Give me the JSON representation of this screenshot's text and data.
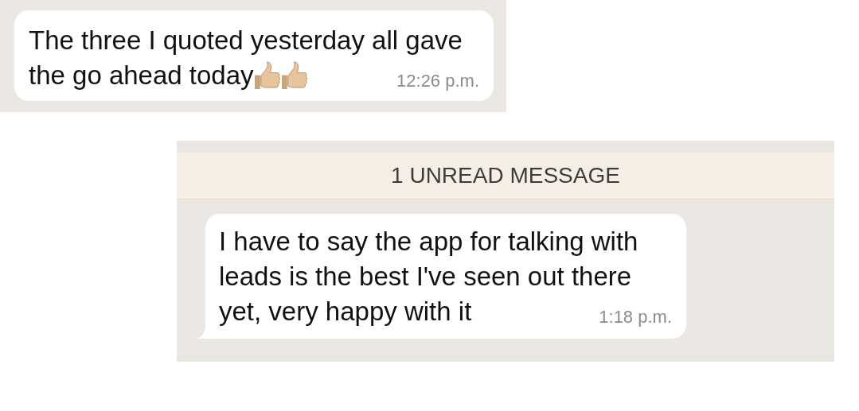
{
  "panels": [
    {
      "message": {
        "lines": [
          "The three I quoted yesterday all gave",
          "the go ahead today"
        ],
        "emojis": [
          {
            "kind": "thumbs_up"
          },
          {
            "kind": "thumbs_up"
          }
        ],
        "time": "12:26 p.m.",
        "tail": false
      }
    },
    {
      "banner": "1 UNREAD MESSAGE",
      "message": {
        "lines": [
          "I have to say the app for talking with",
          "leads is the best I've seen out there",
          "yet, very happy with it"
        ],
        "time": "1:18 p.m.",
        "tail": true
      }
    }
  ]
}
